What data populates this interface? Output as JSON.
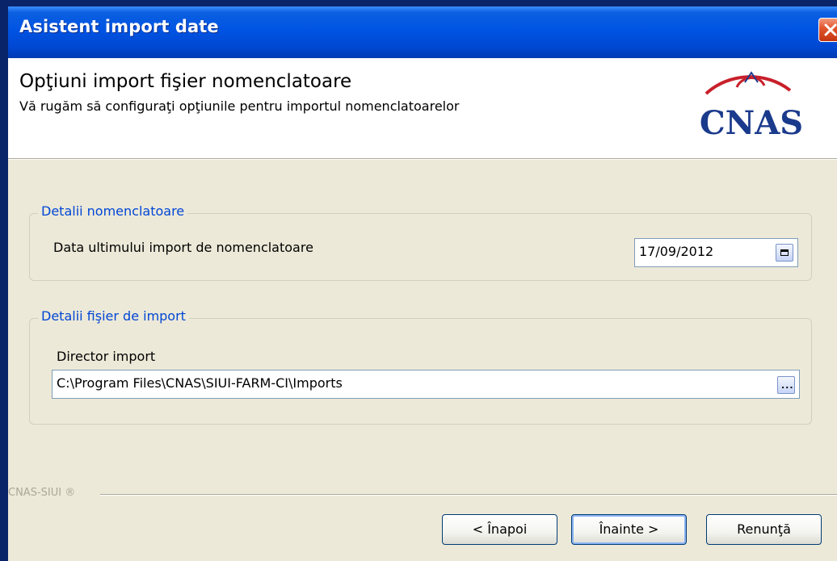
{
  "window": {
    "title": "Asistent import date"
  },
  "header": {
    "title": "Opţiuni import fişier nomenclatoare",
    "subtitle": "Vă rugăm să configuraţi opţiunile pentru importul nomenclatoarelor",
    "logo_text": "CNAS"
  },
  "group_nomenclatoare": {
    "caption": "Detalii nomenclatoare",
    "date_label": "Data ultimului import de nomenclatoare",
    "date_value": "17/09/2012"
  },
  "group_import": {
    "caption": "Detalii fişier de import",
    "dir_label": "Director import",
    "dir_value": "C:\\Program Files\\CNAS\\SIUI-FARM-CI\\Imports",
    "browse_label": "..."
  },
  "footer": {
    "brand": "CNAS-SIUI ®"
  },
  "buttons": {
    "back": "< Înapoi",
    "next": "Înainte >",
    "cancel": "Renunţă"
  },
  "colors": {
    "titlebar": "#0054e3",
    "group_caption": "#0046d5",
    "logo_red": "#c8202a",
    "logo_blue": "#1a3a8c"
  },
  "icons": {
    "close": "close-icon",
    "calendar": "calendar-icon",
    "browse": "ellipsis-icon",
    "logo": "cnas-logo"
  }
}
